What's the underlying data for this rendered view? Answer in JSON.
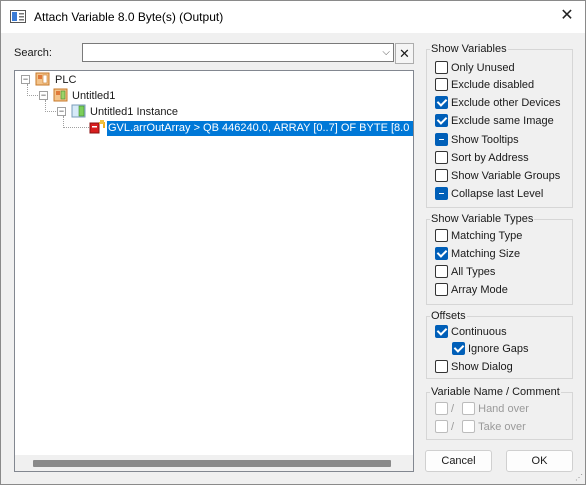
{
  "window": {
    "title": "Attach Variable 8.0 Byte(s) (Output)",
    "close_glyph": "✕"
  },
  "search": {
    "label": "Search:",
    "value": "",
    "dropdown_glyph": "⌵",
    "clear_glyph": "✕"
  },
  "tree": {
    "nodes": [
      {
        "label": "PLC",
        "toggle": "⊟"
      },
      {
        "label": "Untitled1",
        "toggle": "⊟"
      },
      {
        "label": "Untitled1 Instance",
        "toggle": "⊟"
      }
    ],
    "selected_item": "GVL.arrOutArray   >   QB 446240.0, ARRAY [0..7] OF BYTE [8.0"
  },
  "show_variables": {
    "title": "Show Variables",
    "options": [
      {
        "label": "Only Unused",
        "state": "unchecked"
      },
      {
        "label": "Exclude disabled",
        "state": "unchecked"
      },
      {
        "label": "Exclude other Devices",
        "state": "checked"
      },
      {
        "label": "Exclude same Image",
        "state": "checked"
      },
      {
        "label": "Show Tooltips",
        "state": "indeterminate"
      },
      {
        "label": "Sort by Address",
        "state": "unchecked"
      },
      {
        "label": "Show Variable Groups",
        "state": "unchecked"
      },
      {
        "label": "Collapse last Level",
        "state": "indeterminate"
      }
    ]
  },
  "show_variable_types": {
    "title": "Show Variable Types",
    "options": [
      {
        "label": "Matching Type",
        "state": "unchecked"
      },
      {
        "label": "Matching Size",
        "state": "checked"
      },
      {
        "label": "All Types",
        "state": "unchecked"
      },
      {
        "label": "Array Mode",
        "state": "unchecked"
      }
    ]
  },
  "offsets": {
    "title": "Offsets",
    "continuous": {
      "label": "Continuous",
      "state": "checked"
    },
    "ignore_gaps": {
      "label": "Ignore Gaps",
      "state": "checked"
    },
    "show_dialog": {
      "label": "Show Dialog",
      "state": "unchecked"
    }
  },
  "variable_name": {
    "title": "Variable Name / Comment",
    "separator": "/",
    "hand_over": "Hand over",
    "take_over": "Take over"
  },
  "buttons": {
    "cancel": "Cancel",
    "ok": "OK"
  },
  "colors": {
    "selection": "#0078d7",
    "checkbox_accent": "#005fb8"
  }
}
